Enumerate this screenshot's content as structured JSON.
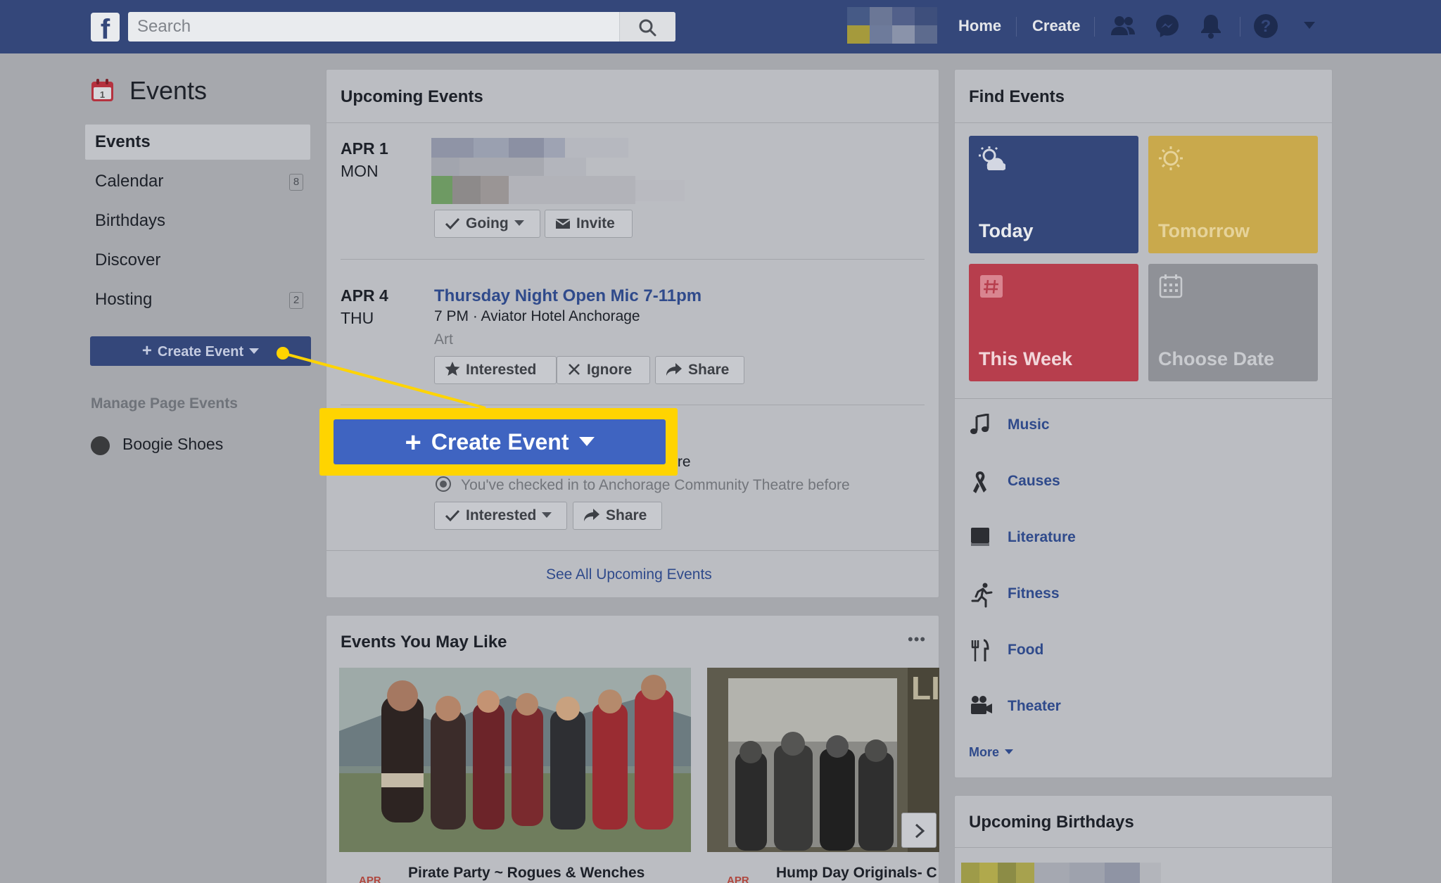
{
  "topbar": {
    "logo": "f",
    "search_placeholder": "Search",
    "home": "Home",
    "create": "Create",
    "icons": [
      "friends-icon",
      "messenger-icon",
      "notifications-icon",
      "help-icon",
      "account-menu-icon"
    ]
  },
  "sidebar": {
    "title": "Events",
    "items": [
      {
        "label": "Events",
        "count": ""
      },
      {
        "label": "Calendar",
        "count": "8"
      },
      {
        "label": "Birthdays",
        "count": ""
      },
      {
        "label": "Discover",
        "count": ""
      },
      {
        "label": "Hosting",
        "count": "2"
      }
    ],
    "create_button": "Create Event",
    "manage_label": "Manage Page Events",
    "page_name": "Boogie Shoes"
  },
  "upcoming": {
    "title": "Upcoming Events",
    "events": [
      {
        "date": "APR 1",
        "dow": "MON",
        "actions": [
          "Going",
          "Invite"
        ]
      },
      {
        "date": "APR 4",
        "dow": "THU",
        "title": "Thursday Night Open Mic 7-11pm",
        "sub": "7 PM · Aviator Hotel Anchorage",
        "category": "Art",
        "actions": [
          "Interested",
          "Ignore",
          "Share"
        ]
      },
      {
        "partial_text": "tre",
        "checkin": "You've checked in to Anchorage Community Theatre before",
        "actions": [
          "Interested",
          "Share"
        ]
      }
    ],
    "see_all": "See All Upcoming Events"
  },
  "may_like": {
    "title": "Events You May Like",
    "menu": "•••",
    "cards": [
      {
        "date": "APR",
        "title": "Pirate Party ~ Rogues & Wenches"
      },
      {
        "date": "APR",
        "title": "Hump Day Originals- C"
      }
    ],
    "banner_text": "LI"
  },
  "find_events": {
    "title": "Find Events",
    "tiles": [
      {
        "label": "Today",
        "color": "#34477a",
        "text_color": "#e9ebee"
      },
      {
        "label": "Tomorrow",
        "color": "#c9a94c",
        "text_color": "#e6d39a"
      },
      {
        "label": "This Week",
        "color": "#b73e4d",
        "text_color": "#f2d6da"
      },
      {
        "label": "Choose Date",
        "color": "#8f9197",
        "text_color": "#c9cbcf"
      }
    ],
    "categories": [
      {
        "label": "Music",
        "icon": "music-note-icon"
      },
      {
        "label": "Causes",
        "icon": "ribbon-icon"
      },
      {
        "label": "Literature",
        "icon": "book-icon"
      },
      {
        "label": "Fitness",
        "icon": "running-icon"
      },
      {
        "label": "Food",
        "icon": "utensils-icon"
      },
      {
        "label": "Theater",
        "icon": "camera-icon"
      }
    ],
    "more": "More"
  },
  "birthdays": {
    "title": "Upcoming Birthdays"
  },
  "highlight": {
    "label": "Create Event",
    "accent": "#ffd400",
    "button_color": "#3f64c1"
  }
}
